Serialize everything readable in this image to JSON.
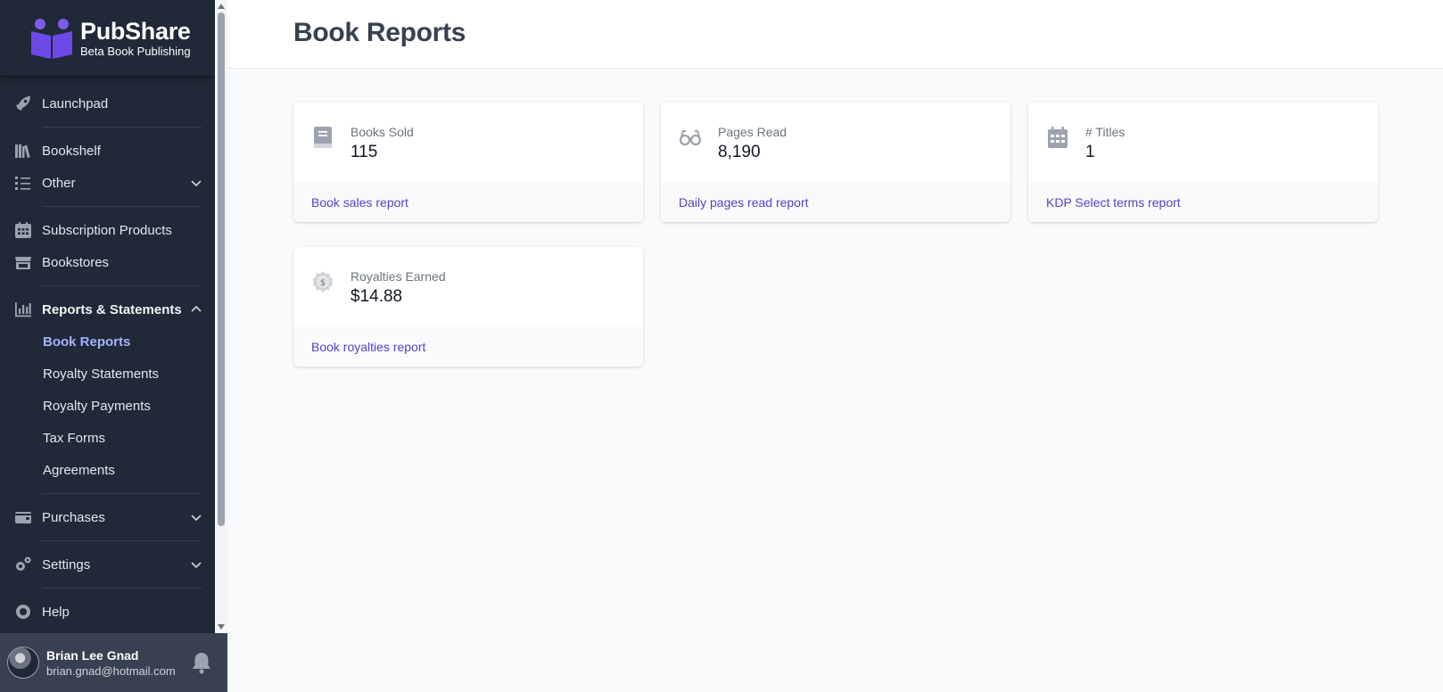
{
  "brand": {
    "name": "PubShare",
    "tagline": "Beta Book Publishing"
  },
  "sidebar": {
    "items": [
      {
        "label": "Launchpad",
        "icon": "rocket-icon"
      },
      {
        "label": "Bookshelf",
        "icon": "bookshelf-icon"
      },
      {
        "label": "Other",
        "icon": "list-icon"
      },
      {
        "label": "Subscription Products",
        "icon": "calendar-icon"
      },
      {
        "label": "Bookstores",
        "icon": "store-icon"
      },
      {
        "label": "Reports & Statements",
        "icon": "chart-icon"
      },
      {
        "label": "Purchases",
        "icon": "wallet-icon"
      },
      {
        "label": "Settings",
        "icon": "gears-icon"
      },
      {
        "label": "Help",
        "icon": "lifebuoy-icon"
      }
    ],
    "reports_sub": [
      {
        "label": "Book Reports",
        "active": true
      },
      {
        "label": "Royalty Statements"
      },
      {
        "label": "Royalty Payments"
      },
      {
        "label": "Tax Forms"
      },
      {
        "label": "Agreements"
      }
    ]
  },
  "user": {
    "name": "Brian Lee Gnad",
    "email": "brian.gnad@hotmail.com"
  },
  "page": {
    "title": "Book Reports"
  },
  "cards": [
    {
      "label": "Books Sold",
      "value": "115",
      "link": "Book sales report",
      "icon": "book-icon"
    },
    {
      "label": "Pages Read",
      "value": "8,190",
      "link": "Daily pages read report",
      "icon": "glasses-icon"
    },
    {
      "label": "# Titles",
      "value": "1",
      "link": "KDP Select terms report",
      "icon": "calendar-icon"
    },
    {
      "label": "Royalties Earned",
      "value": "$14.88",
      "link": "Book royalties report",
      "icon": "dollar-badge-icon"
    }
  ],
  "colors": {
    "sidebar_bg": "#1f2937",
    "accent": "#5b3fc4",
    "active_nav": "#a5b4fc"
  }
}
